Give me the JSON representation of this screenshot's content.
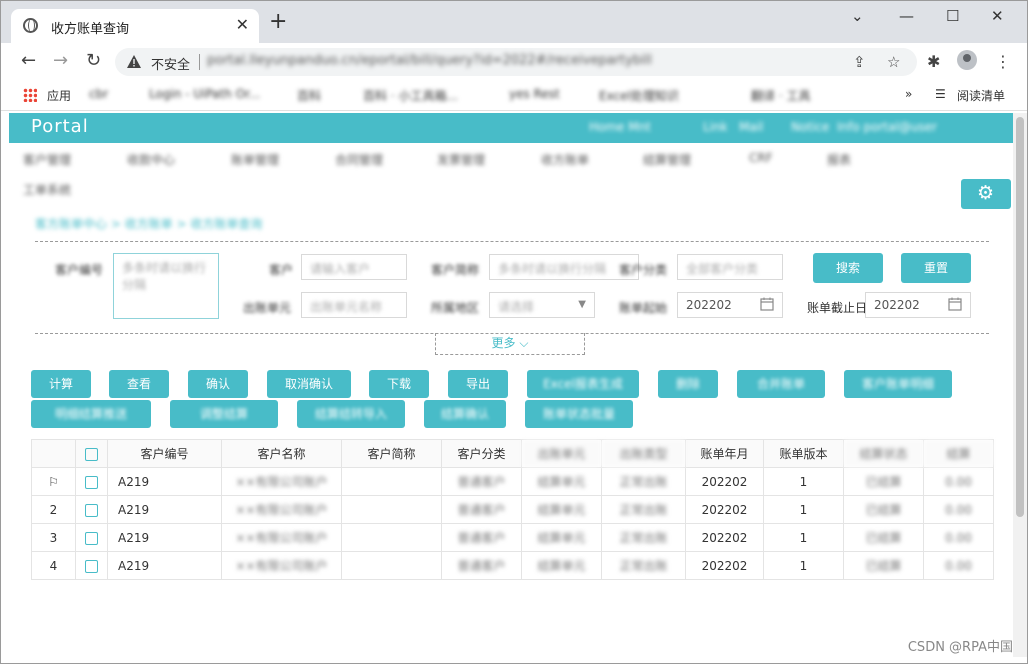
{
  "browser": {
    "tab_title": "收方账单查询",
    "new_tab": "+",
    "security_label": "不安全",
    "url": "portal.lleyunpanduo.cn/eportal/bill/query?id=2022#/receivepartybill",
    "bookmarks_apps": "应用",
    "bookmarks": [
      "cbr",
      "Login - UiPath Or...",
      "百科",
      "百科 · 小工具箱...",
      "yes Rest",
      "Excel处理知识",
      "翻译 · 工具"
    ],
    "reading_list": "阅读清单"
  },
  "portal": {
    "logo": "Portal",
    "header_right": [
      "Home Mnt",
      "Link",
      "Mail",
      "Notice",
      "Info portal@user"
    ],
    "menu_items": [
      "客户管理",
      "收款中心",
      "账单管理",
      "合同管理",
      "发票管理",
      "收方账单",
      "结算管理",
      "CRF",
      "报表",
      "工单系统"
    ],
    "crumb": "客方账单中心 > 收方账单 > 收方账单查询"
  },
  "form": {
    "customer_no_label": "客户编号",
    "customer_no_placeholder": "多条时请以换行分隔",
    "customer_label": "客户",
    "customer_placeholder": "请输入客户",
    "customer_abbr_label": "客户简称",
    "customer_abbr_placeholder": "多条时请以换行分隔",
    "customer_type_label": "客户分类",
    "customer_type_value": "全部客户分类",
    "out_unit_label": "出账单元",
    "out_unit_placeholder": "出账单元名称",
    "region_label": "所属地区",
    "region_value": "请选择",
    "bill_start_label": "账单起始",
    "bill_start_value": "202202",
    "bill_end_label": "账单截止日",
    "bill_end_value": "202202",
    "search_button": "搜索",
    "reset_button": "重置",
    "more_button": "更多 ⌵"
  },
  "actions": {
    "row1": [
      "计算",
      "查看",
      "确认",
      "取消确认",
      "下载",
      "导出",
      "Excel报表生成",
      "删除",
      "合并账单",
      "客户账单明细"
    ],
    "row2": [
      "明细结算推送",
      "调整结算",
      "结算结转导入",
      "结算确认",
      "账单状态批量"
    ]
  },
  "table": {
    "headers": [
      "",
      "",
      "客户编号",
      "客户名称",
      "客户简称",
      "客户分类",
      "出账单元",
      "出账类型",
      "账单年月",
      "账单版本",
      "结算状态",
      "结算"
    ],
    "rows": [
      {
        "idx": "",
        "flag": true,
        "no": "A219",
        "name": "××有限公司账户",
        "abbr": "",
        "type": "普通客户",
        "unit": "结算单元",
        "kind": "正常出账",
        "ym": "202202",
        "ver": "1",
        "status": "已结算",
        "amt": "0.00"
      },
      {
        "idx": "2",
        "flag": false,
        "no": "A219",
        "name": "××有限公司账户",
        "abbr": "",
        "type": "普通客户",
        "unit": "结算单元",
        "kind": "正常出账",
        "ym": "202202",
        "ver": "1",
        "status": "已结算",
        "amt": "0.00"
      },
      {
        "idx": "3",
        "flag": false,
        "no": "A219",
        "name": "××有限公司账户",
        "abbr": "",
        "type": "普通客户",
        "unit": "结算单元",
        "kind": "正常出账",
        "ym": "202202",
        "ver": "1",
        "status": "已结算",
        "amt": "0.00"
      },
      {
        "idx": "4",
        "flag": false,
        "no": "A219",
        "name": "××有限公司账户",
        "abbr": "",
        "type": "普通客户",
        "unit": "结算单元",
        "kind": "正常出账",
        "ym": "202202",
        "ver": "1",
        "status": "已结算",
        "amt": "0.00"
      }
    ]
  },
  "watermark": "CSDN @RPA中国",
  "colors": {
    "accent": "#48bcc8",
    "tabstrip": "#dee1e6"
  }
}
